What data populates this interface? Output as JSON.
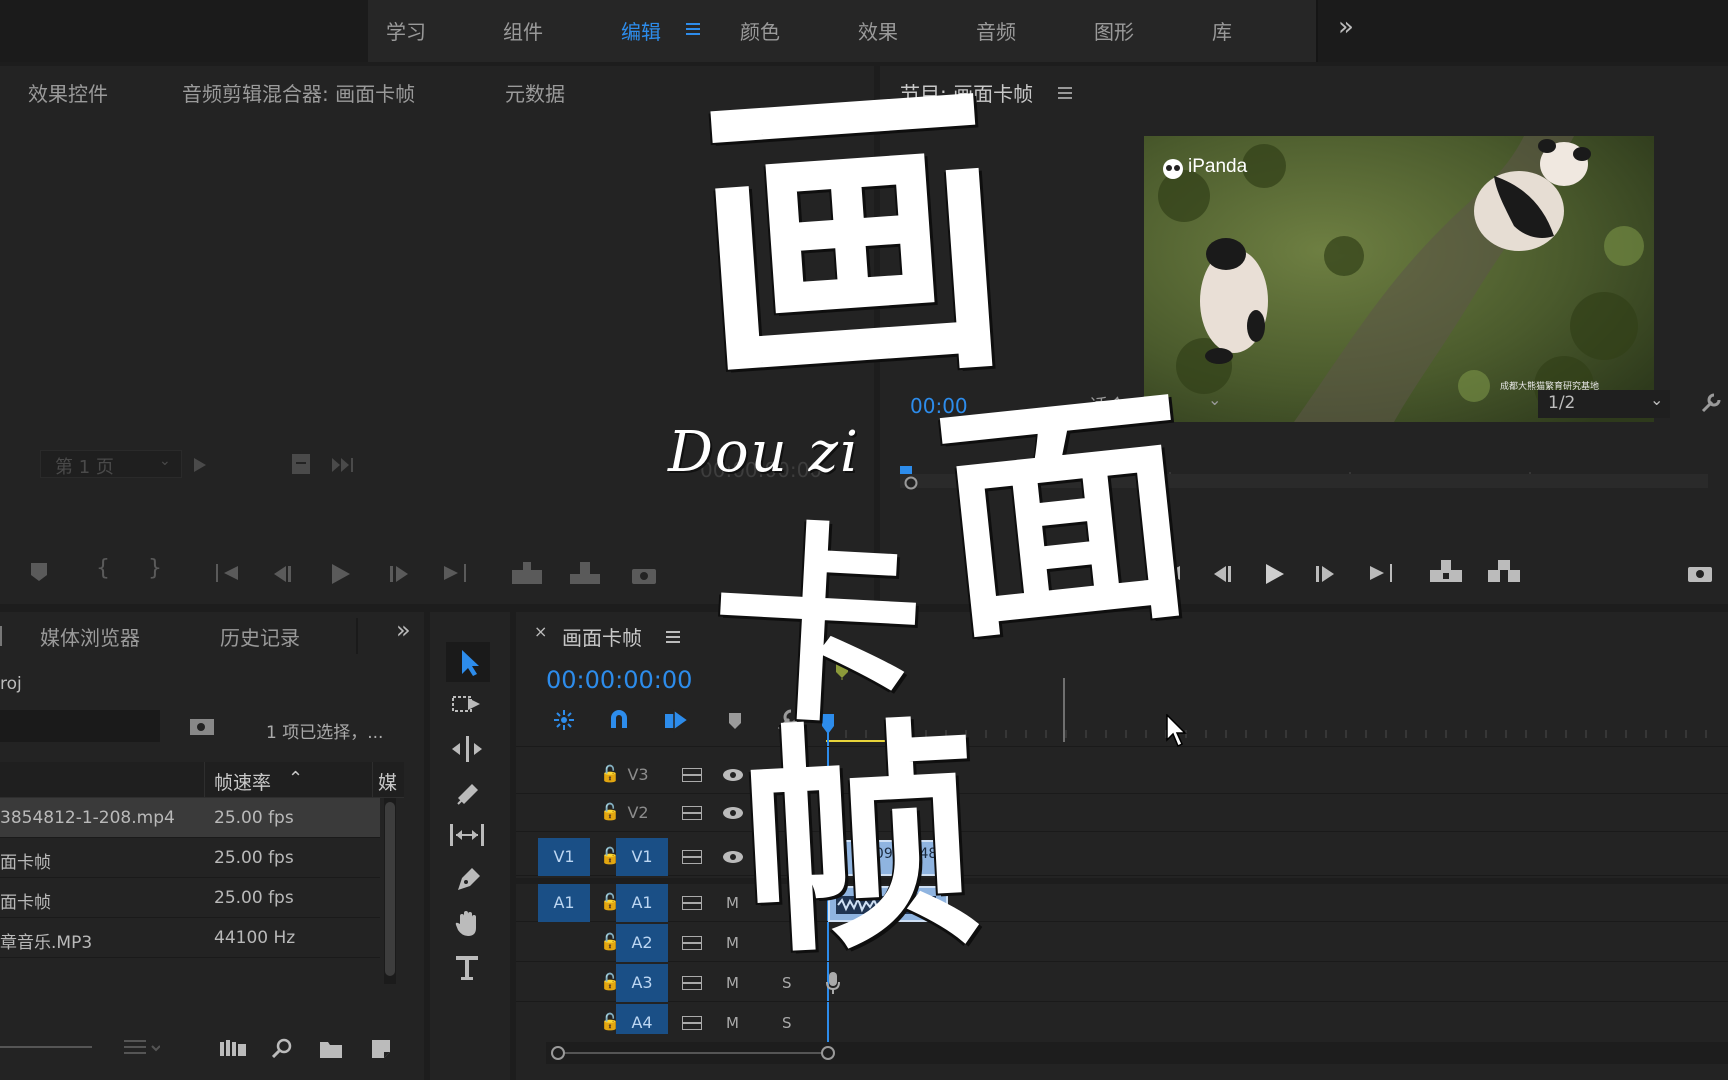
{
  "workspaces": {
    "items": [
      "学习",
      "组件",
      "编辑",
      "颜色",
      "效果",
      "音频",
      "图形",
      "库"
    ],
    "active_index": 2,
    "more": "»"
  },
  "source_panel": {
    "tabs": [
      "效果控件",
      "音频剪辑混合器: 画面卡帧",
      "元数据"
    ],
    "page_select": "第 1 页",
    "timecode": "00:00:00:00"
  },
  "program_monitor": {
    "title": "节目: 画面卡帧",
    "timecode": "00:00",
    "fit_select": "适合",
    "resolution_select": "1/2",
    "watermark": "iPanda",
    "corner_watermark": "成都大熊猫繁育研究基地"
  },
  "project_panel": {
    "tabs": [
      "媒体浏览器",
      "历史记录"
    ],
    "project_name": "roj",
    "selection_status": "1 项已选择，...",
    "columns": [
      "帧速率",
      "媒"
    ],
    "rows": [
      {
        "name": "3854812-1-208.mp4",
        "rate": "25.00 fps"
      },
      {
        "name": "面卡帧",
        "rate": "25.00 fps"
      },
      {
        "name": "面卡帧",
        "rate": "25.00 fps"
      },
      {
        "name": "章音乐.MP3",
        "rate": "44100 Hz"
      }
    ]
  },
  "timeline": {
    "sequence_name": "画面卡帧",
    "timecode": "00:00:00:00",
    "video_tracks": [
      {
        "src": "",
        "name": "V3",
        "m": ""
      },
      {
        "src": "",
        "name": "V2",
        "m": ""
      },
      {
        "src": "V1",
        "name": "V1",
        "m": ""
      }
    ],
    "audio_tracks": [
      {
        "src": "A1",
        "name": "A1",
        "m": "M",
        "s": ""
      },
      {
        "src": "",
        "name": "A2",
        "m": "M",
        "s": ""
      },
      {
        "src": "",
        "name": "A3",
        "m": "M",
        "s": "S"
      },
      {
        "src": "",
        "name": "A4",
        "m": "M",
        "s": "S"
      }
    ],
    "video_clip_label": "10988548"
  },
  "overlay": {
    "script_text": "Dou zi",
    "title_chars": [
      "画",
      "面",
      "卡",
      "帧"
    ]
  },
  "colors": {
    "accent": "#2d8ceb",
    "track_active": "#1a4f86",
    "clip_video": "#8fb4e0",
    "work_area": "#e8d43a",
    "playhead": "#2d8ceb"
  }
}
